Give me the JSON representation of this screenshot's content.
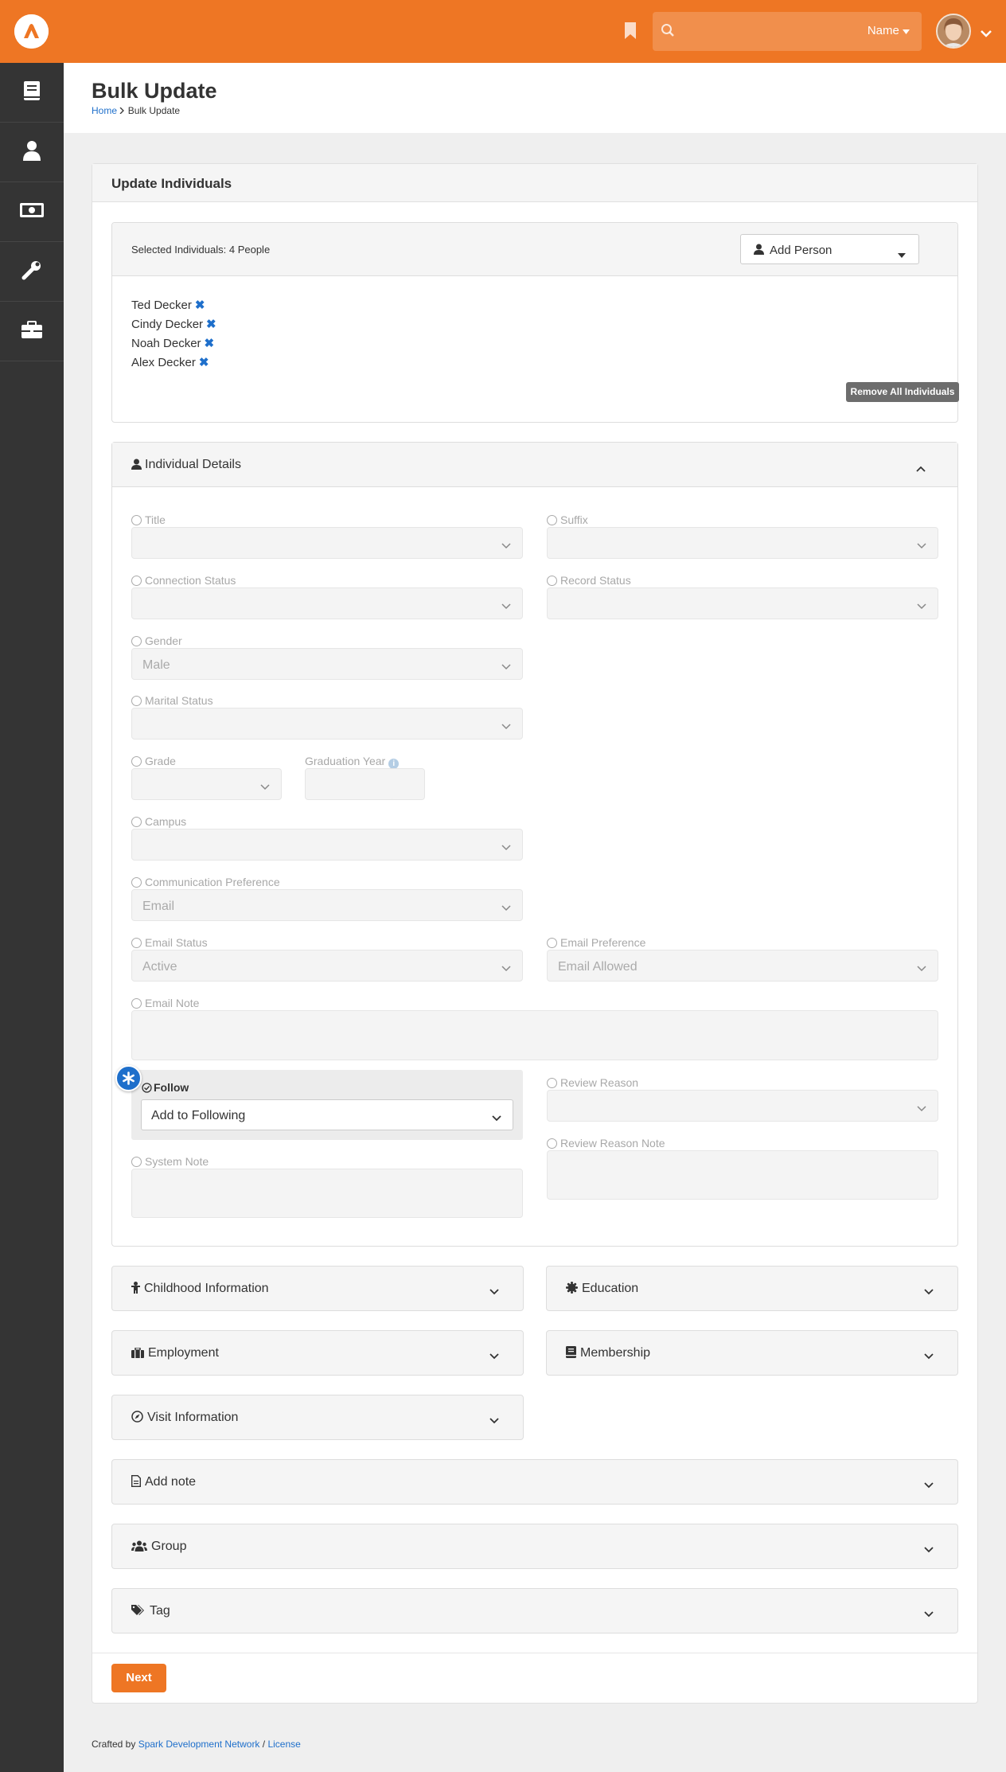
{
  "header": {
    "search_placeholder": "",
    "search_scope": "Name"
  },
  "page": {
    "title": "Bulk Update",
    "breadcrumb": [
      "Home",
      "Bulk Update"
    ]
  },
  "panel": {
    "title": "Update Individuals"
  },
  "selection": {
    "count_label": "Selected Individuals: 4 People",
    "add_person_label": "Add Person",
    "people": [
      "Ted Decker",
      "Cindy Decker",
      "Noah Decker",
      "Alex Decker"
    ],
    "remove_all_label": "Remove All Individuals"
  },
  "individual_details": {
    "title": "Individual Details",
    "fields": {
      "title": {
        "label": "Title",
        "value": ""
      },
      "suffix": {
        "label": "Suffix",
        "value": ""
      },
      "connection_status": {
        "label": "Connection Status",
        "value": ""
      },
      "record_status": {
        "label": "Record Status",
        "value": ""
      },
      "gender": {
        "label": "Gender",
        "value": "Male"
      },
      "marital_status": {
        "label": "Marital Status",
        "value": ""
      },
      "grade": {
        "label": "Grade",
        "value": ""
      },
      "graduation_year": {
        "label": "Graduation Year",
        "value": ""
      },
      "campus": {
        "label": "Campus",
        "value": ""
      },
      "communication_preference": {
        "label": "Communication Preference",
        "value": "Email"
      },
      "email_status": {
        "label": "Email Status",
        "value": "Active"
      },
      "email_preference": {
        "label": "Email Preference",
        "value": "Email Allowed"
      },
      "email_note": {
        "label": "Email Note",
        "value": ""
      },
      "follow": {
        "label": "Follow",
        "value": "Add to Following"
      },
      "review_reason": {
        "label": "Review Reason",
        "value": ""
      },
      "review_reason_note": {
        "label": "Review Reason Note",
        "value": ""
      },
      "system_note": {
        "label": "System Note",
        "value": ""
      }
    }
  },
  "sections": {
    "childhood": "Childhood Information",
    "education": "Education",
    "employment": "Employment",
    "membership": "Membership",
    "visit": "Visit Information",
    "add_note": "Add note",
    "group": "Group",
    "tag": "Tag"
  },
  "actions": {
    "next_label": "Next"
  },
  "footer": {
    "prefix": "Crafted by",
    "org": "Spark Development Network",
    "separator": "/",
    "license": "License"
  },
  "colors": {
    "brand": "#ee7624",
    "link": "#1e6fcb",
    "sidebar": "#343434"
  }
}
